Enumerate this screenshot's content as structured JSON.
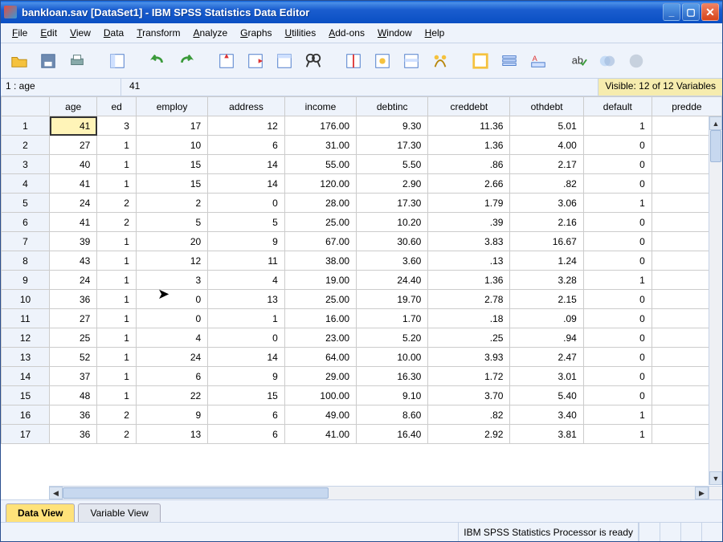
{
  "title": "bankloan.sav [DataSet1] - IBM SPSS Statistics Data Editor",
  "menus": [
    "File",
    "Edit",
    "View",
    "Data",
    "Transform",
    "Analyze",
    "Graphs",
    "Utilities",
    "Add-ons",
    "Window",
    "Help"
  ],
  "toolbar_icons": [
    "open",
    "save",
    "print",
    "insert-var",
    "undo",
    "redo",
    "goto-case",
    "goto-var",
    "variables",
    "find",
    "split",
    "weight",
    "select",
    "value-labels",
    "scale",
    "var-sets",
    "use-vars",
    "spellcheck",
    "overlap",
    "circle"
  ],
  "infobar": {
    "cell_ref": "1 : age",
    "cell_value": "41",
    "visible": "Visible: 12 of 12 Variables"
  },
  "columns": [
    "age",
    "ed",
    "employ",
    "address",
    "income",
    "debtinc",
    "creddebt",
    "othdebt",
    "default",
    "predde"
  ],
  "rows": [
    {
      "n": 1,
      "v": [
        "41",
        "3",
        "17",
        "12",
        "176.00",
        "9.30",
        "11.36",
        "5.01",
        "1",
        ""
      ]
    },
    {
      "n": 2,
      "v": [
        "27",
        "1",
        "10",
        "6",
        "31.00",
        "17.30",
        "1.36",
        "4.00",
        "0",
        ""
      ]
    },
    {
      "n": 3,
      "v": [
        "40",
        "1",
        "15",
        "14",
        "55.00",
        "5.50",
        ".86",
        "2.17",
        "0",
        ""
      ]
    },
    {
      "n": 4,
      "v": [
        "41",
        "1",
        "15",
        "14",
        "120.00",
        "2.90",
        "2.66",
        ".82",
        "0",
        ""
      ]
    },
    {
      "n": 5,
      "v": [
        "24",
        "2",
        "2",
        "0",
        "28.00",
        "17.30",
        "1.79",
        "3.06",
        "1",
        ""
      ]
    },
    {
      "n": 6,
      "v": [
        "41",
        "2",
        "5",
        "5",
        "25.00",
        "10.20",
        ".39",
        "2.16",
        "0",
        ""
      ]
    },
    {
      "n": 7,
      "v": [
        "39",
        "1",
        "20",
        "9",
        "67.00",
        "30.60",
        "3.83",
        "16.67",
        "0",
        ""
      ]
    },
    {
      "n": 8,
      "v": [
        "43",
        "1",
        "12",
        "11",
        "38.00",
        "3.60",
        ".13",
        "1.24",
        "0",
        ""
      ]
    },
    {
      "n": 9,
      "v": [
        "24",
        "1",
        "3",
        "4",
        "19.00",
        "24.40",
        "1.36",
        "3.28",
        "1",
        ""
      ]
    },
    {
      "n": 10,
      "v": [
        "36",
        "1",
        "0",
        "13",
        "25.00",
        "19.70",
        "2.78",
        "2.15",
        "0",
        ""
      ]
    },
    {
      "n": 11,
      "v": [
        "27",
        "1",
        "0",
        "1",
        "16.00",
        "1.70",
        ".18",
        ".09",
        "0",
        ""
      ]
    },
    {
      "n": 12,
      "v": [
        "25",
        "1",
        "4",
        "0",
        "23.00",
        "5.20",
        ".25",
        ".94",
        "0",
        ""
      ]
    },
    {
      "n": 13,
      "v": [
        "52",
        "1",
        "24",
        "14",
        "64.00",
        "10.00",
        "3.93",
        "2.47",
        "0",
        ""
      ]
    },
    {
      "n": 14,
      "v": [
        "37",
        "1",
        "6",
        "9",
        "29.00",
        "16.30",
        "1.72",
        "3.01",
        "0",
        ""
      ]
    },
    {
      "n": 15,
      "v": [
        "48",
        "1",
        "22",
        "15",
        "100.00",
        "9.10",
        "3.70",
        "5.40",
        "0",
        ""
      ]
    },
    {
      "n": 16,
      "v": [
        "36",
        "2",
        "9",
        "6",
        "49.00",
        "8.60",
        ".82",
        "3.40",
        "1",
        ""
      ]
    },
    {
      "n": 17,
      "v": [
        "36",
        "2",
        "13",
        "6",
        "41.00",
        "16.40",
        "2.92",
        "3.81",
        "1",
        ""
      ]
    }
  ],
  "selected": {
    "row": 1,
    "col": 0
  },
  "tabs": {
    "data": "Data View",
    "variable": "Variable View",
    "active": "data"
  },
  "status": "IBM SPSS Statistics Processor is ready"
}
